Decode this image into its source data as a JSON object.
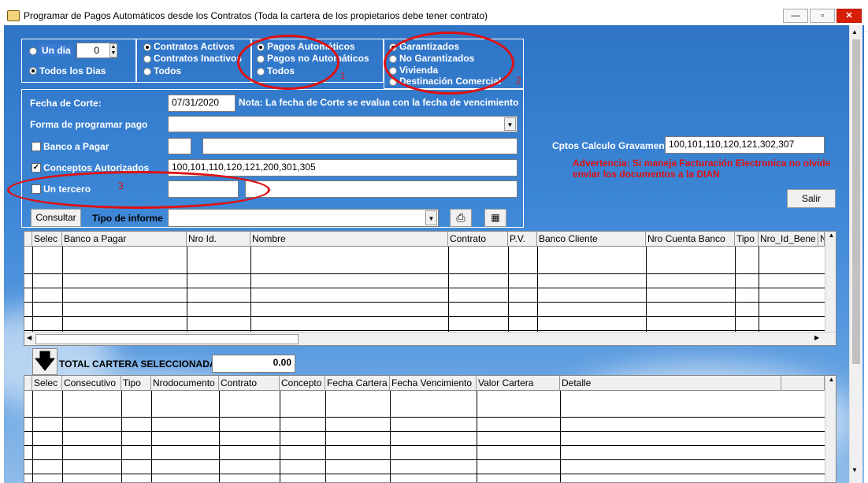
{
  "window": {
    "title": "Programar de Pagos Automáticos desde los Contratos (Toda la cartera de los propietarios debe tener contrato)"
  },
  "days": {
    "un_dia_label": "Un dia",
    "un_dia_value": "0",
    "todos_dias_label": "Todos los Dias",
    "selected": "todos"
  },
  "contratos": {
    "activos": "Contratos Activos",
    "inactivos": "Contratos Inactivos",
    "todos": "Todos",
    "selected": "activos"
  },
  "pagos": {
    "automaticos": "Pagos Automáticos",
    "no_automaticos": "Pagos no Automáticos",
    "todos": "Todos",
    "selected": "automaticos"
  },
  "garantia": {
    "garantizados": "Garantizados",
    "no_garantizados": "No Garantizados",
    "vivienda": "Vivienda",
    "destinacion": "Destinación Comercial"
  },
  "form": {
    "fecha_corte_label": "Fecha de Corte:",
    "fecha_corte_value": "07/31/2020",
    "nota": "Nota: La fecha de Corte se evalua con la fecha de vencimiento",
    "forma_label": "Forma de programar pago",
    "forma_value": "",
    "banco_label": "Banco a Pagar",
    "banco_checked": false,
    "conceptos_label": "Conceptos Autorizados",
    "conceptos_checked": true,
    "conceptos_value": "100,101,110,120,121,200,301,305",
    "tercero_label": "Un tercero",
    "tercero_checked": false,
    "consultar": "Consultar",
    "tipo_informe_label": "Tipo de informe",
    "tipo_informe_value": ""
  },
  "right": {
    "cptos_label": "Cptos Calculo Gravamen",
    "cptos_value": "100,101,110,120,121,302,307",
    "warning": "Advertencia: Si maneja Facturación Electronica no olvide enviar los documentos a la DIAN",
    "salir": "Salir"
  },
  "grid1": {
    "headers": [
      "Selec",
      "Banco a Pagar",
      "Nro Id.",
      "Nombre",
      "Contrato",
      "P.V.",
      "Banco Cliente",
      "Nro Cuenta Banco",
      "Tipo",
      "Nro_Id_Bene",
      "N"
    ]
  },
  "total": {
    "label": "TOTAL CARTERA SELECCIONADA",
    "value": "0.00"
  },
  "grid2": {
    "headers": [
      "Selec",
      "Consecutivo",
      "Tipo",
      "Nrodocumento",
      "Contrato",
      "Concepto",
      "Fecha Cartera",
      "Fecha Vencimiento",
      "Valor Cartera",
      "Detalle",
      ""
    ]
  },
  "annotations": [
    "1",
    "2",
    "3"
  ],
  "colors": {
    "annotation": "#e01010",
    "warning": "#e01010"
  }
}
